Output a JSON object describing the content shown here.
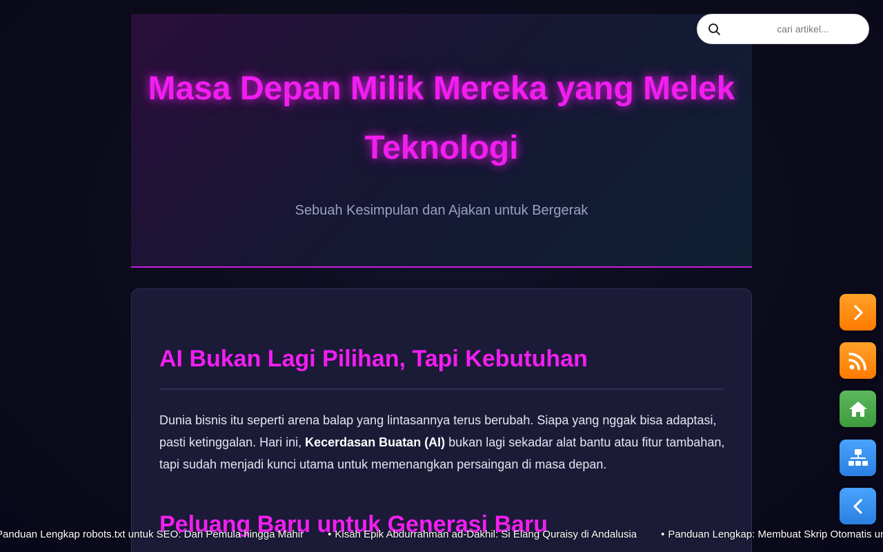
{
  "hero": {
    "title": "Masa Depan Milik Mereka yang Melek Teknologi",
    "subtitle": "Sebuah Kesimpulan dan Ajakan untuk Bergerak"
  },
  "search": {
    "placeholder": "cari artikel...",
    "icon": "search-icon"
  },
  "article": {
    "heading1": "AI Bukan Lagi Pilihan, Tapi Kebutuhan",
    "paragraph": {
      "before": "Dunia bisnis itu seperti arena balap yang lintasannya terus berubah. Siapa yang nggak bisa adaptasi, pasti ketinggalan. Hari ini, ",
      "bold": "Kecerdasan Buatan (AI)",
      "after": " bukan lagi sekadar alat bantu atau fitur tambahan, tapi sudah menjadi kunci utama untuk memenangkan persaingan di masa depan."
    },
    "heading2": "Peluang Baru untuk Generasi Baru"
  },
  "floating_buttons": [
    {
      "name": "next",
      "icon": "chevron-right-icon",
      "color": "#ff8c1a"
    },
    {
      "name": "rss",
      "icon": "rss-icon",
      "color": "#ff8c1a"
    },
    {
      "name": "home",
      "icon": "home-icon",
      "color": "#4caf50"
    },
    {
      "name": "sitemap",
      "icon": "sitemap-icon",
      "color": "#3b8ff0"
    },
    {
      "name": "prev",
      "icon": "chevron-left-icon",
      "color": "#3b8ff0"
    }
  ],
  "ticker": {
    "items": [
      "Panduan Lengkap robots.txt untuk SEO: Dari Pemula hingga Mahir",
      "Kisah Epik Abdurrahman ad-Dakhil: Si Elang Quraisy di Andalusia",
      "Panduan Lengkap: Membuat Skrip Otomatis untuk"
    ],
    "bullet": "•"
  },
  "colors": {
    "accent": "#f21ef0",
    "background": "#0b0b1a",
    "card": "#1b1b38"
  }
}
